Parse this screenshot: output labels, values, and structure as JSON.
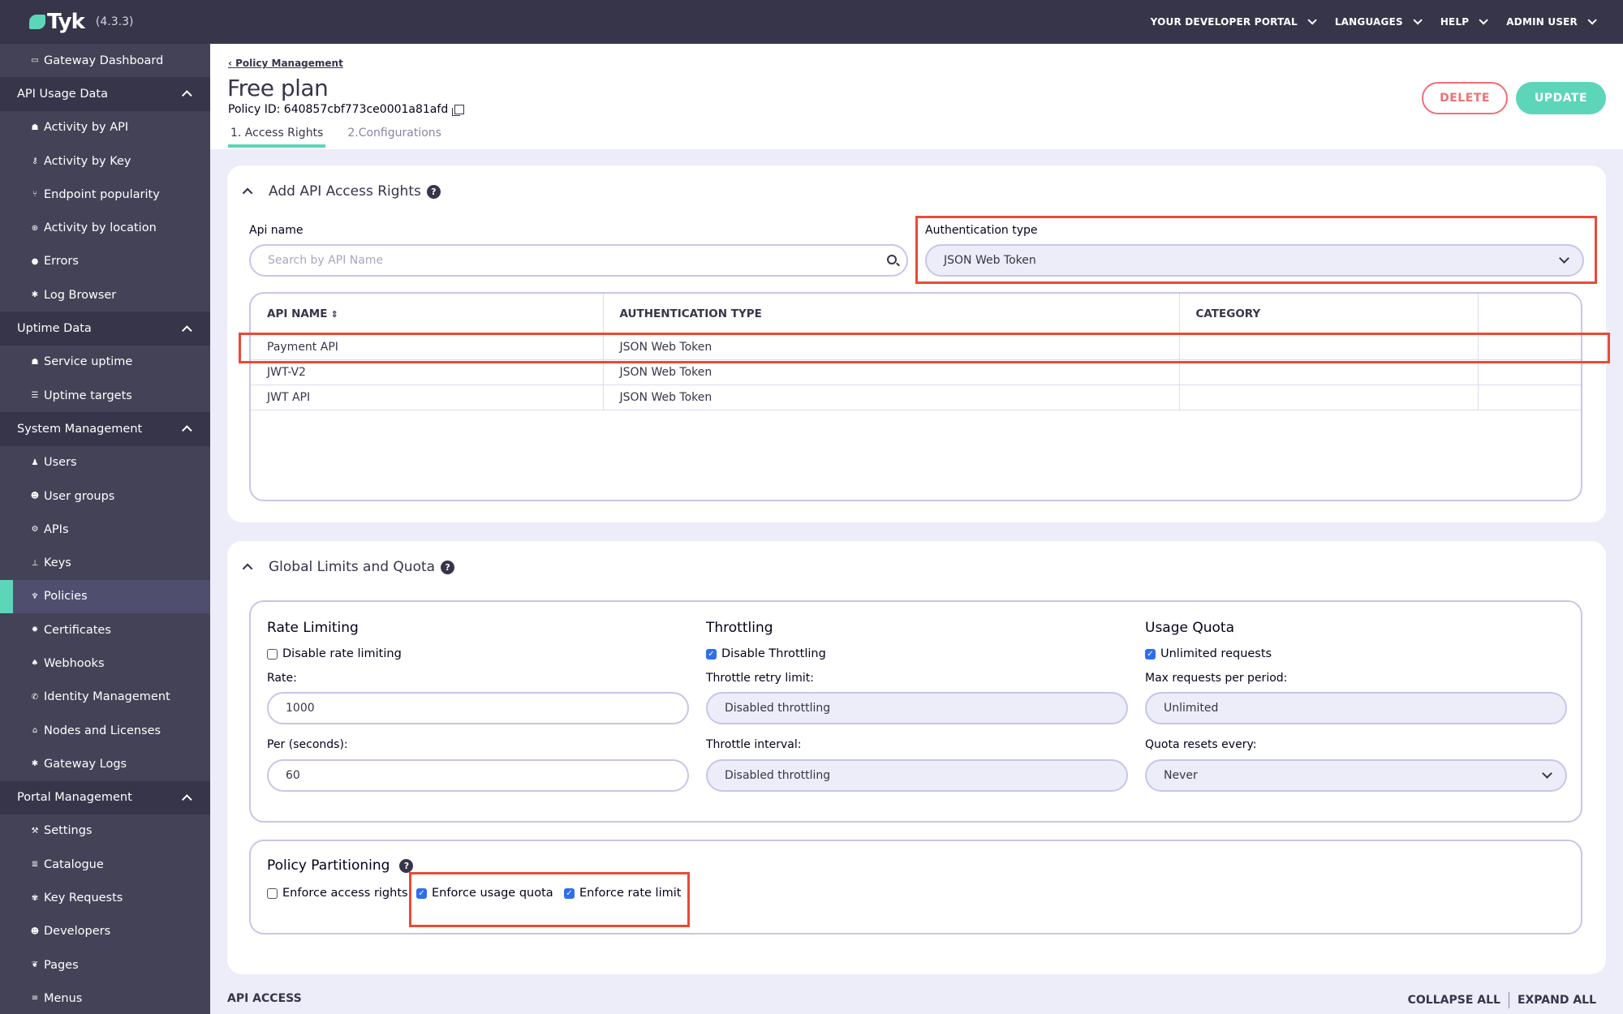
{
  "topbar": {
    "logo_text": "Tyk",
    "version": "(4.3.3)",
    "nav": [
      {
        "label": "YOUR DEVELOPER PORTAL"
      },
      {
        "label": "LANGUAGES"
      },
      {
        "label": "HELP"
      },
      {
        "label": "ADMIN USER"
      }
    ]
  },
  "sidebar": {
    "top_item": {
      "label": "Gateway Dashboard",
      "icon": "monitor-icon"
    },
    "sections": [
      {
        "title": "API Usage Data",
        "items": [
          {
            "label": "Activity by API",
            "icon": "cubes-icon"
          },
          {
            "label": "Activity by Key",
            "icon": "key-icon"
          },
          {
            "label": "Endpoint popularity",
            "icon": "branch-icon"
          },
          {
            "label": "Activity by location",
            "icon": "globe-icon"
          },
          {
            "label": "Errors",
            "icon": "bomb-icon"
          },
          {
            "label": "Log Browser",
            "icon": "bug-icon"
          }
        ]
      },
      {
        "title": "Uptime Data",
        "items": [
          {
            "label": "Service uptime",
            "icon": "cubes-icon"
          },
          {
            "label": "Uptime targets",
            "icon": "list-icon"
          }
        ]
      },
      {
        "title": "System Management",
        "items": [
          {
            "label": "Users",
            "icon": "user-icon"
          },
          {
            "label": "User groups",
            "icon": "users-icon"
          },
          {
            "label": "APIs",
            "icon": "cogs-icon"
          },
          {
            "label": "Keys",
            "icon": "sitemap-icon"
          },
          {
            "label": "Policies",
            "icon": "plug-icon",
            "active": true
          },
          {
            "label": "Certificates",
            "icon": "certificate-icon"
          },
          {
            "label": "Webhooks",
            "icon": "bell-icon"
          },
          {
            "label": "Identity Management",
            "icon": "phone-icon"
          },
          {
            "label": "Nodes and Licenses",
            "icon": "bank-icon"
          },
          {
            "label": "Gateway Logs",
            "icon": "bug-icon"
          }
        ]
      },
      {
        "title": "Portal Management",
        "items": [
          {
            "label": "Settings",
            "icon": "wrench-icon"
          },
          {
            "label": "Catalogue",
            "icon": "catalogue-icon"
          },
          {
            "label": "Key Requests",
            "icon": "paw-icon"
          },
          {
            "label": "Developers",
            "icon": "users-icon"
          },
          {
            "label": "Pages",
            "icon": "leaf-icon"
          },
          {
            "label": "Menus",
            "icon": "bars-icon"
          }
        ]
      }
    ]
  },
  "header": {
    "breadcrumb": "Policy Management",
    "title": "Free plan",
    "policy_id": "Policy ID: 640857cbf773ce0001a81afd",
    "tabs": [
      {
        "label": "1. Access Rights",
        "active": true
      },
      {
        "label": "2.Configurations",
        "active": false
      }
    ],
    "delete_label": "DELETE",
    "update_label": "UPDATE"
  },
  "access_rights": {
    "title": "Add API Access Rights",
    "api_name_label": "Api name",
    "api_name_placeholder": "Search by API Name",
    "auth_type_label": "Authentication type",
    "auth_type_value": "JSON Web Token",
    "table": {
      "columns": [
        "API NAME",
        "AUTHENTICATION TYPE",
        "CATEGORY",
        ""
      ],
      "rows": [
        [
          "Payment API",
          "JSON Web Token",
          "",
          ""
        ],
        [
          "JWT-V2",
          "JSON Web Token",
          "",
          ""
        ],
        [
          "JWT API",
          "JSON Web Token",
          "",
          ""
        ]
      ]
    }
  },
  "limits": {
    "title": "Global Limits and Quota",
    "rate_limiting": {
      "title": "Rate Limiting",
      "disable_label": "Disable rate limiting",
      "disable_checked": false,
      "rate_label": "Rate:",
      "rate_value": "1000",
      "per_label": "Per (seconds):",
      "per_value": "60"
    },
    "throttling": {
      "title": "Throttling",
      "disable_label": "Disable Throttling",
      "disable_checked": true,
      "retry_label": "Throttle retry limit:",
      "retry_value": "Disabled throttling",
      "interval_label": "Throttle interval:",
      "interval_value": "Disabled throttling"
    },
    "usage_quota": {
      "title": "Usage Quota",
      "unlimited_label": "Unlimited requests",
      "unlimited_checked": true,
      "max_label": "Max requests per period:",
      "max_value": "Unlimited",
      "resets_label": "Quota resets every:",
      "resets_value": "Never"
    },
    "partitioning": {
      "title": "Policy Partitioning",
      "options": [
        {
          "label": "Enforce access rights",
          "checked": false
        },
        {
          "label": "Enforce usage quota",
          "checked": true
        },
        {
          "label": "Enforce rate limit",
          "checked": true
        }
      ]
    }
  },
  "footer": {
    "title": "API ACCESS",
    "collapse_all": "COLLAPSE ALL",
    "expand_all": "EXPAND ALL"
  },
  "colors": {
    "accent": "#5dd5b9",
    "danger": "#ef6f76",
    "sidebar_bg": "#434257",
    "topbar_bg": "#373549",
    "highlight_box": "#ea4a35"
  }
}
